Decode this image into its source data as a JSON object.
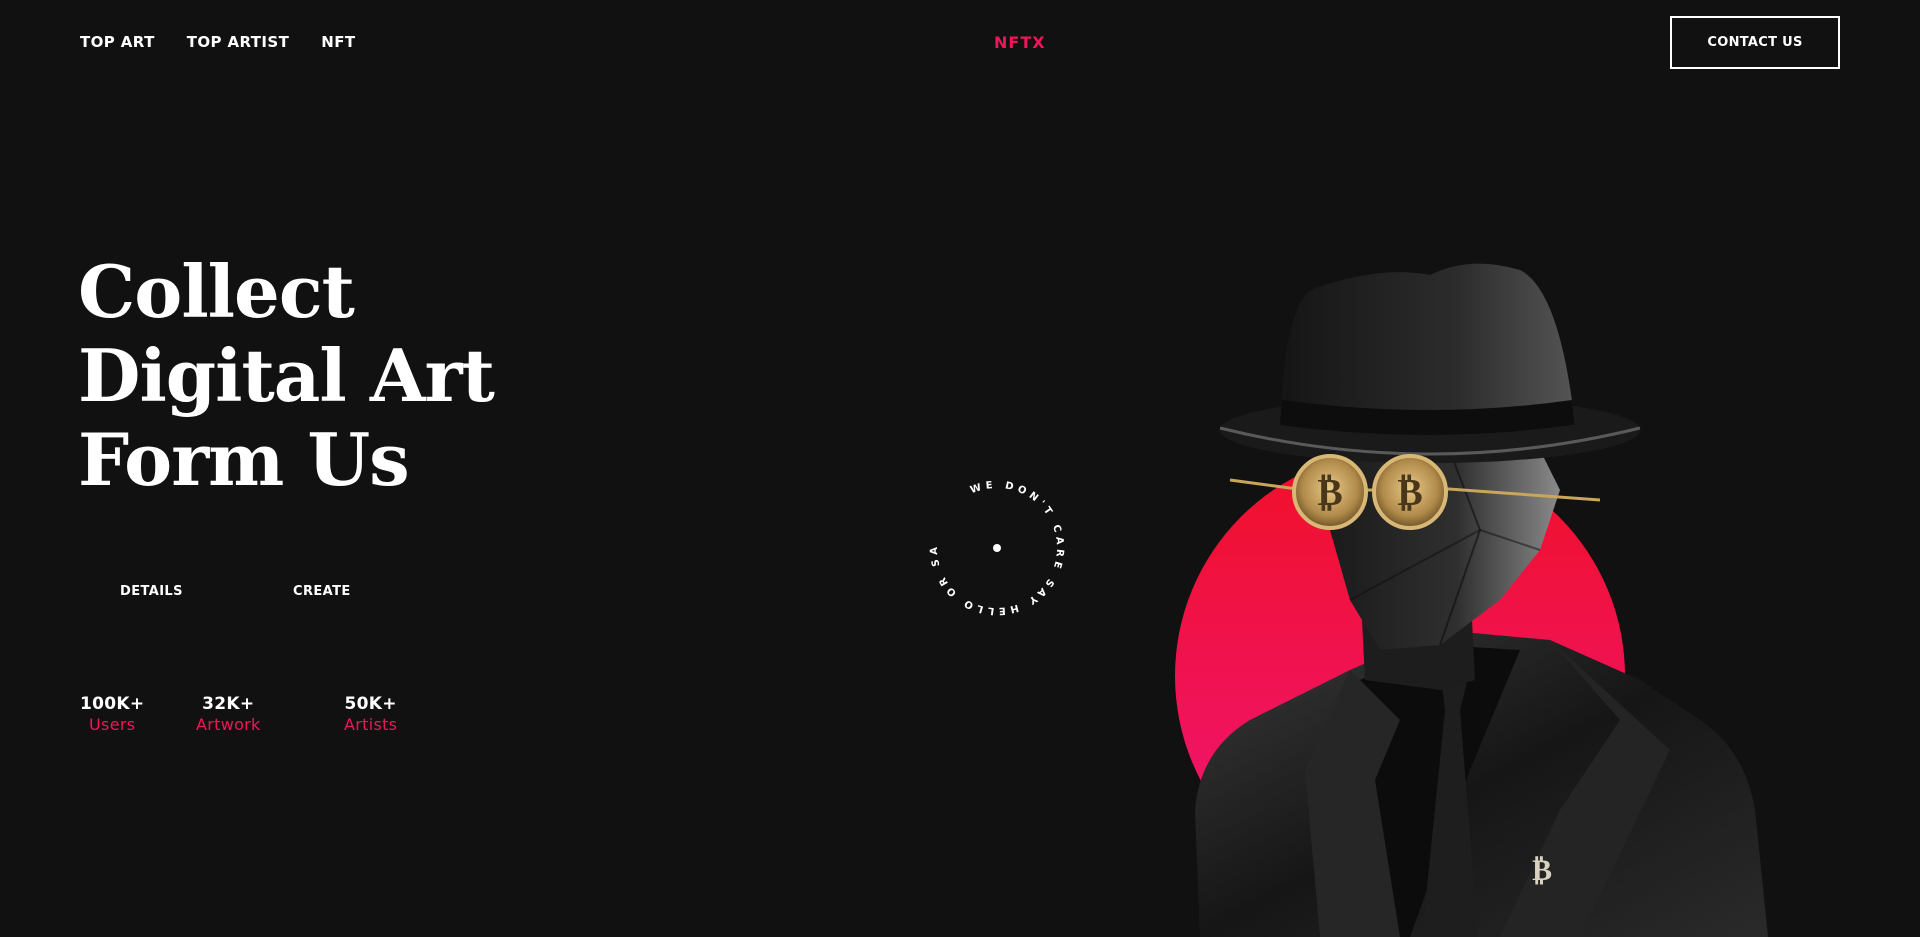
{
  "header": {
    "nav": [
      "TOP ART",
      "TOP ARTIST",
      "NFT"
    ],
    "brand": "NFTX",
    "contact_label": "CONTACT US"
  },
  "hero": {
    "title_lines": [
      "Collect",
      "Digital Art",
      "Form Us"
    ],
    "details_label": "DETAILS",
    "create_label": "CREATE"
  },
  "stats": [
    {
      "value": "100K+",
      "label": "Users"
    },
    {
      "value": "32K+",
      "label": "Artwork"
    },
    {
      "value": "50K+",
      "label": "Artists"
    }
  ],
  "badge": {
    "text": "WE DON'T CARE SAY HELLO OR SAY HI"
  },
  "colors": {
    "background": "#111111",
    "accent": "#f0165a",
    "text": "#ffffff"
  },
  "artwork": {
    "icon": "bitcoin-figure-illustration",
    "glasses_symbol": "₿",
    "pin_symbol": "₿"
  }
}
